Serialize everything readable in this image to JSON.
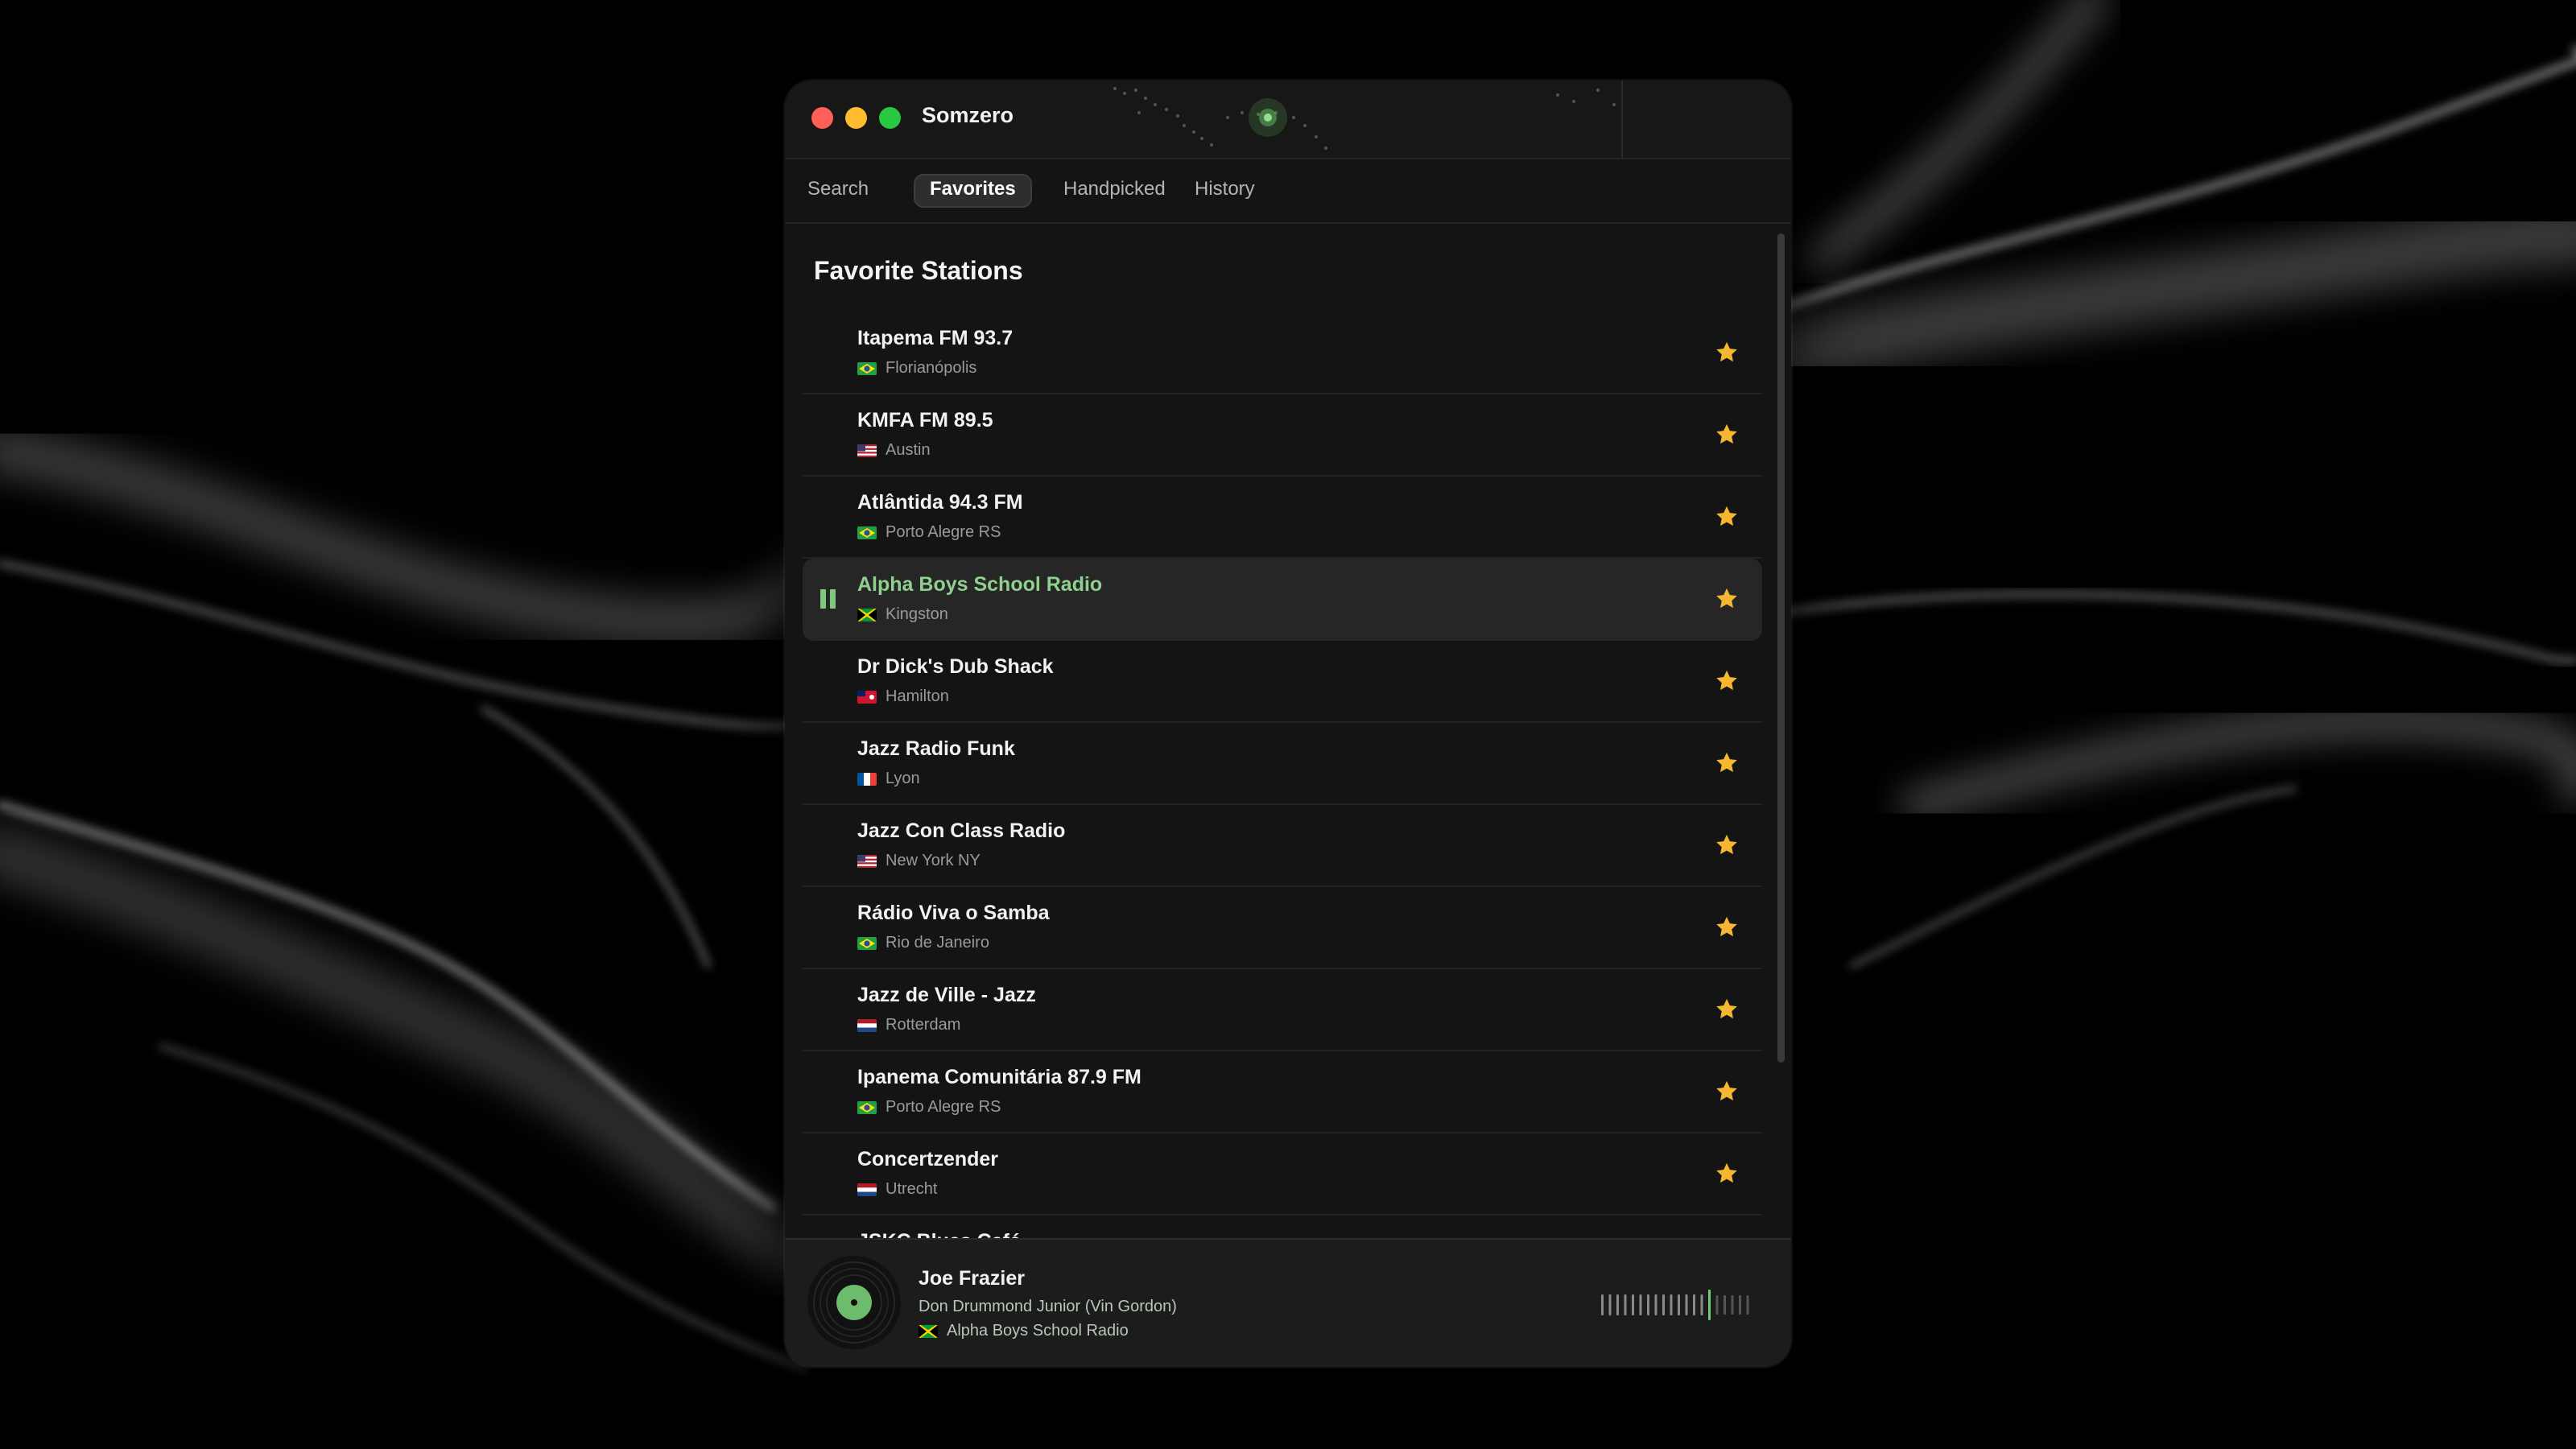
{
  "app": {
    "title": "Somzero"
  },
  "tabs": [
    {
      "label": "Search",
      "active": false
    },
    {
      "label": "Favorites",
      "active": true
    },
    {
      "label": "Handpicked",
      "active": false
    },
    {
      "label": "History",
      "active": false
    }
  ],
  "favorites": {
    "heading": "Favorite Stations",
    "stations": [
      {
        "name": "Itapema FM 93.7",
        "location": "Florianópolis",
        "flag": "brazil-flag-icon",
        "playing": false
      },
      {
        "name": "KMFA FM 89.5",
        "location": "Austin",
        "flag": "usa-flag-icon",
        "playing": false
      },
      {
        "name": "Atlântida 94.3 FM",
        "location": "Porto Alegre RS",
        "flag": "brazil-flag-icon",
        "playing": false
      },
      {
        "name": "Alpha Boys School Radio",
        "location": "Kingston",
        "flag": "jamaica-flag-icon",
        "playing": true
      },
      {
        "name": "Dr Dick's Dub Shack",
        "location": "Hamilton",
        "flag": "bermuda-flag-icon",
        "playing": false
      },
      {
        "name": "Jazz Radio Funk",
        "location": "Lyon",
        "flag": "france-flag-icon",
        "playing": false
      },
      {
        "name": "Jazz Con Class Radio",
        "location": "New York NY",
        "flag": "usa-flag-icon",
        "playing": false
      },
      {
        "name": "Rádio Viva o Samba",
        "location": "Rio de Janeiro",
        "flag": "brazil-flag-icon",
        "playing": false
      },
      {
        "name": "Jazz de Ville - Jazz",
        "location": "Rotterdam",
        "flag": "netherlands-flag-icon",
        "playing": false
      },
      {
        "name": "Ipanema Comunitária 87.9 FM",
        "location": "Porto Alegre RS",
        "flag": "brazil-flag-icon",
        "playing": false
      },
      {
        "name": "Concertzender",
        "location": "Utrecht",
        "flag": "netherlands-flag-icon",
        "playing": false
      },
      {
        "name": "JSKC Blues Café",
        "location": "",
        "flag": "",
        "playing": false
      }
    ]
  },
  "now_playing": {
    "title": "Joe Frazier",
    "artist": "Don Drummond Junior (Vin Gordon)",
    "station": "Alpha Boys School Radio",
    "station_flag": "jamaica-flag-icon"
  },
  "colors": {
    "accent_green": "#8fd08f",
    "star_gold": "#f5b731",
    "window_bg": "#141414"
  }
}
